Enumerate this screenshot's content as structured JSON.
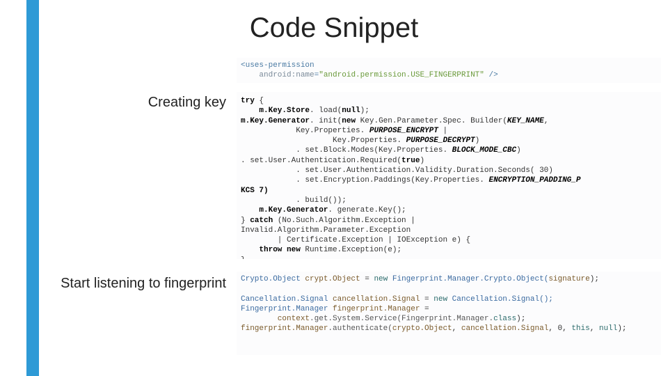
{
  "title": "Code Snippet",
  "labels": {
    "creating_key": "Creating key",
    "start_listening": "Start listening to fingerprint"
  },
  "code": {
    "perm": {
      "tag_open": "<uses-permission",
      "attr_name": "android:name",
      "attr_value": "\"android.permission.USE_FINGERPRINT\"",
      "tag_close": "/>"
    },
    "try": {
      "l1a": "try",
      "l1b": " {",
      "l2a": "    m.Key.Store",
      "l2b": ". load(",
      "l2c": "null",
      "l2d": ");",
      "l3a": "m.Key.Generator",
      "l3b": ". init(",
      "l3c": "new",
      "l3d": " Key.Gen.Parameter.Spec. Builder(",
      "l3e": "KEY_NAME",
      "l3f": ",",
      "l4a": "            Key.Properties. ",
      "l4b": "PURPOSE_ENCRYPT",
      "l4c": " |",
      "l5a": "                    Key.Properties. ",
      "l5b": "PURPOSE_DECRYPT",
      "l5c": ")",
      "l6a": "            . set.Block.Modes(Key.Properties. ",
      "l6b": "BLOCK_MODE_CBC",
      "l6c": ")",
      "l7a": ". set.User.Authentication.Required(",
      "l7b": "true",
      "l7c": ")",
      "l8": "            . set.User.Authentication.Validity.Duration.Seconds( 30)",
      "l9a": "            . set.Encryption.Paddings(Key.Properties. ",
      "l9b": "ENCRYPTION_PADDING_P",
      "l10": "KCS 7)",
      "l11": "            . build());",
      "l12a": "    m.Key.Generator",
      "l12b": ". generate.Key();",
      "l13a": "} ",
      "l13b": "catch",
      "l13c": " (No.Such.Algorithm.Exception |",
      "l14": "Invalid.Algorithm.Parameter.Exception",
      "l15": "        | Certificate.Exception | IOException e) {",
      "l16a": "    throw new",
      "l16b": " Runtime.Exception(e);",
      "l17": "}"
    },
    "fp": {
      "l1a": "Crypto.Object ",
      "l1b": "crypt.Object",
      "l1c": " = ",
      "l1d": "new",
      "l1e": " Fingerprint.Manager.Crypto.Object(",
      "l1f": "signature",
      "l1g": ");",
      "l2a": "Cancellation.Signal ",
      "l2b": "cancellation.Signal",
      "l2c": " = ",
      "l2d": "new",
      "l2e": " Cancellation.Signal();",
      "l3a": "Fingerprint.Manager ",
      "l3b": "fingerprint.Manager",
      "l3c": " =",
      "l4a": "        context",
      "l4b": ".get.System.Service(Fingerprint.Manager.",
      "l4c": "class",
      "l4d": ");",
      "l5a": "fingerprint.Manager",
      "l5b": ".authenticate(",
      "l5c": "crypto.Object",
      "l5d": ", ",
      "l5e": "cancellation.Signal",
      "l5f": ", 0, ",
      "l5g": "this",
      "l5h": ", ",
      "l5i": "null",
      "l5j": ");"
    }
  }
}
